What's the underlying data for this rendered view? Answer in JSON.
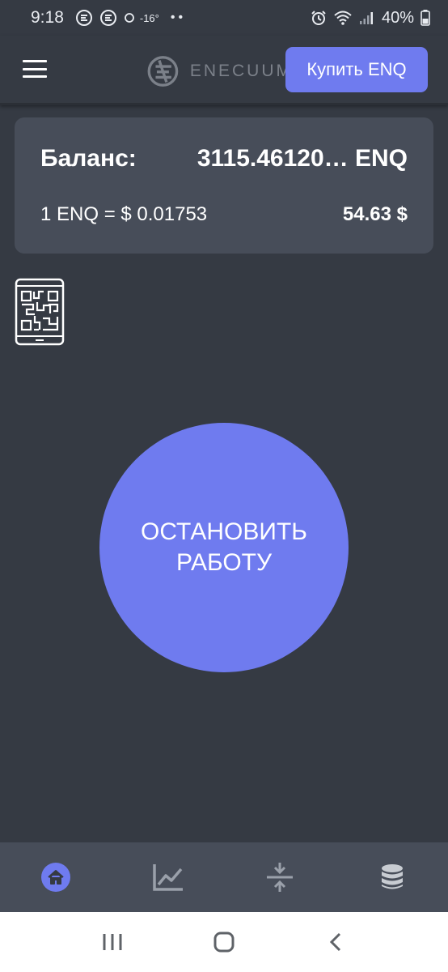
{
  "status_bar": {
    "time": "9:18",
    "temperature": "-16°",
    "battery": "40%"
  },
  "header": {
    "logo_text": "ENECUUM",
    "buy_button": "Купить ENQ"
  },
  "balance": {
    "label": "Баланс:",
    "amount": "3115.46120… ENQ",
    "rate": "1 ENQ = $ 0.01753",
    "usd": "54.63 $"
  },
  "main": {
    "stop_button": "ОСТАНОВИТЬ РАБОТУ"
  },
  "bottom_nav": {
    "active": "home",
    "items": [
      "home-icon",
      "chart-icon",
      "compress-icon",
      "database-icon"
    ]
  },
  "colors": {
    "background": "#353a43",
    "card": "#474d59",
    "accent": "#6f7bef",
    "active_nav": "#6f7bef",
    "inactive_nav": "#9aa0aa"
  }
}
